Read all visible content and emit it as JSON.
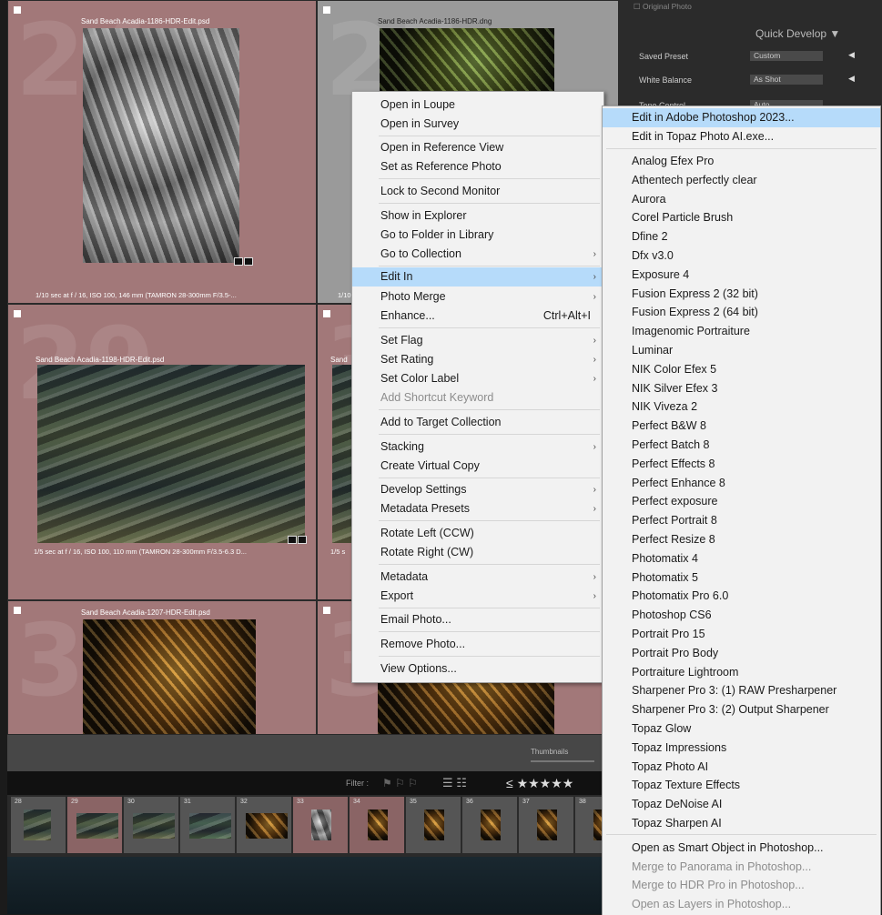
{
  "grid": {
    "cells": [
      {
        "num": "24",
        "filename": "Sand Beach Acadia-1186-HDR-Edit.psd",
        "info": "1/10 sec at f / 16, ISO 100, 146 mm (TAMRON 28-300mm F/3.5-..."
      },
      {
        "num": "25",
        "filename": "Sand Beach Acadia-1186-HDR.dng",
        "info": "1/10"
      },
      {
        "num": "29",
        "filename": "Sand Beach Acadia-1198-HDR-Edit.psd",
        "info": "1/5 sec at f / 16, ISO 100, 110 mm (TAMRON 28-300mm F/3.5-6.3 D..."
      },
      {
        "num": "30",
        "filename": "Sand",
        "info": "1/5 s"
      },
      {
        "num": "34",
        "filename": "Sand Beach Acadia-1207-HDR-Edit.psd",
        "info": ""
      },
      {
        "num": "35",
        "filename": "",
        "info": ""
      }
    ]
  },
  "toolbar": {
    "thumbnails_label": "Thumbnails"
  },
  "filterbar": {
    "filter_label": "Filter :",
    "stars": "≤ ★★★★★"
  },
  "filmstrip": {
    "items": [
      "28",
      "29",
      "30",
      "31",
      "32",
      "33",
      "34",
      "35",
      "36",
      "37",
      "38"
    ]
  },
  "rpanel": {
    "original_photo": "Original Photo",
    "section_title": "Quick Develop",
    "saved_preset_label": "Saved Preset",
    "saved_preset_value": "Custom",
    "white_balance_label": "White Balance",
    "white_balance_value": "As Shot",
    "tone_control_label": "Tone Control",
    "tone_control_value": "Auto"
  },
  "context_menu": {
    "items": [
      "Open in Loupe",
      "Open in Survey",
      "Open in Reference View",
      "Set as Reference Photo",
      "Lock to Second Monitor",
      "Show in Explorer",
      "Go to Folder in Library",
      "Go to Collection",
      "Edit In",
      "Photo Merge",
      "Enhance...",
      "Set Flag",
      "Set Rating",
      "Set Color Label",
      "Add Shortcut Keyword",
      "Add to Target Collection",
      "Stacking",
      "Create Virtual Copy",
      "Develop Settings",
      "Metadata Presets",
      "Rotate Left (CCW)",
      "Rotate Right (CW)",
      "Metadata",
      "Export",
      "Email Photo...",
      "Remove Photo...",
      "View Options..."
    ],
    "enhance_shortcut": "Ctrl+Alt+I"
  },
  "submenu": {
    "items": [
      "Edit in Adobe Photoshop 2023...",
      "Edit in Topaz Photo AI.exe...",
      "Analog Efex Pro",
      "Athentech perfectly clear",
      "Aurora",
      "Corel Particle Brush",
      "Dfine 2",
      "Dfx v3.0",
      "Exposure 4",
      "Fusion Express 2 (32 bit)",
      "Fusion Express 2 (64 bit)",
      "Imagenomic Portraiture",
      "Luminar",
      "NIK Color Efex 5",
      "NIK Silver Efex 3",
      "NIK Viveza 2",
      "Perfect B&W 8",
      "Perfect Batch 8",
      "Perfect Effects 8",
      "Perfect Enhance 8",
      "Perfect exposure",
      "Perfect Portrait 8",
      "Perfect Resize 8",
      "Photomatix 4",
      "Photomatix 5",
      "Photomatix Pro 6.0",
      "Photoshop CS6",
      "Portrait Pro 15",
      "Portrait Pro Body",
      "Portraiture Lightroom",
      "Sharpener Pro 3: (1) RAW Presharpener",
      "Sharpener Pro 3: (2) Output Sharpener",
      "Topaz Glow",
      "Topaz Impressions",
      "Topaz Photo AI",
      "Topaz Texture Effects",
      "Topaz DeNoise AI",
      "Topaz Sharpen AI",
      "Open as Smart Object in Photoshop...",
      "Merge to Panorama in Photoshop...",
      "Merge to HDR Pro in Photoshop...",
      "Open as Layers in Photoshop..."
    ]
  },
  "colors": {
    "menu_highlight": "#b6dbfa",
    "cell_selected": "#a27879",
    "menu_bg": "#f2f2f2"
  }
}
